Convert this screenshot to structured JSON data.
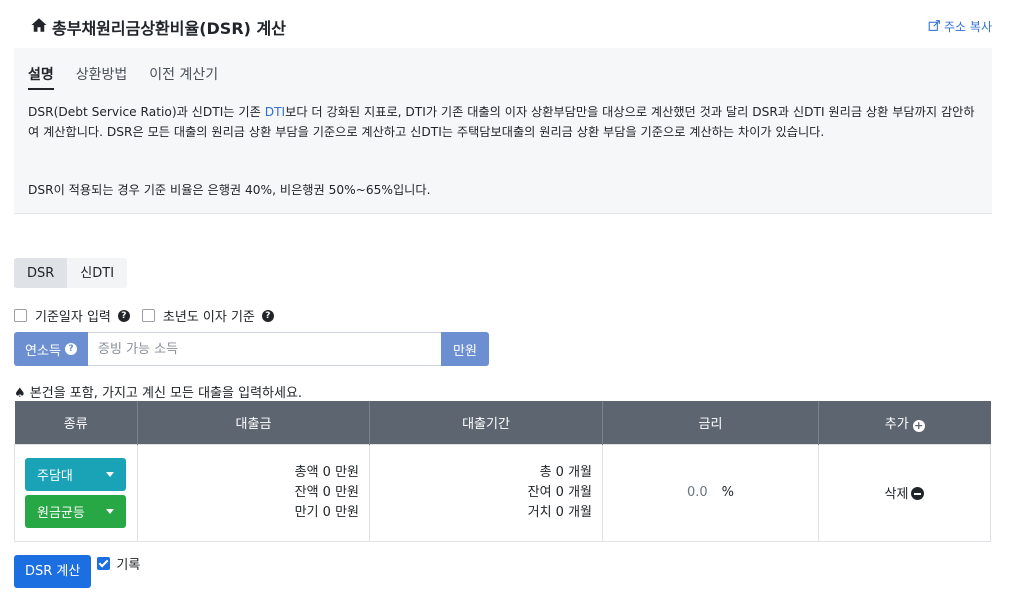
{
  "header": {
    "title": "총부채원리금상환비율(DSR) 계산",
    "copy_label": "주소 복사"
  },
  "info": {
    "tabs": [
      {
        "label": "설명"
      },
      {
        "label": "상환방법"
      },
      {
        "label": "이전 계산기"
      }
    ],
    "paragraph1_before": "DSR(Debt Service Ratio)과 신DTI는 기존 ",
    "paragraph1_link": "DTI",
    "paragraph1_after": "보다 더 강화된 지표로, DTI가 기존 대출의 이자 상환부담만을 대상으로 계산했던 것과 달리 DSR과 신DTI 원리금 상환 부담까지 감안하여 계산합니다. DSR은 모든 대출의 원리금 상환 부담을 기준으로 계산하고 신DTI는 주택담보대출의 원리금 상환 부담을 기준으로 계산하는 차이가 있습니다.",
    "paragraph2": "DSR이 적용되는 경우 기준 비율은 은행권 40%, 비은행권 50%~65%입니다."
  },
  "mode_toggle": {
    "dsr": "DSR",
    "new_dti": "신DTI"
  },
  "options": {
    "base_date": "기준일자 입력",
    "first_year_interest": "초년도 이자 기준"
  },
  "income": {
    "label": "연소득",
    "placeholder": "증빙 가능 소득",
    "unit": "만원"
  },
  "note": "♠ 본건을 포함, 가지고 계신 모든 대출을 입력하세요.",
  "table": {
    "headers": {
      "type": "종류",
      "amount": "대출금",
      "term": "대출기간",
      "rate": "금리",
      "add": "추가"
    },
    "row": {
      "loan_type": "주담대",
      "repay_type": "원금균등",
      "amount_total": "총액 0 만원",
      "amount_balance": "잔액 0 만원",
      "amount_maturity": "만기 0 만원",
      "term_total": "총 0 개월",
      "term_remain": "잔여 0 개월",
      "term_grace": "거치 0 개월",
      "rate_value": "0.0",
      "rate_unit": "%",
      "delete_label": "삭제"
    }
  },
  "actions": {
    "calc_label": "DSR 계산",
    "record_label": "기록"
  },
  "colors": {
    "accent_blue": "#1b6fe0",
    "teal": "#1aa2b7",
    "green": "#27a844",
    "header_gray": "#5d6670",
    "income_blue": "#6c8fd1"
  }
}
